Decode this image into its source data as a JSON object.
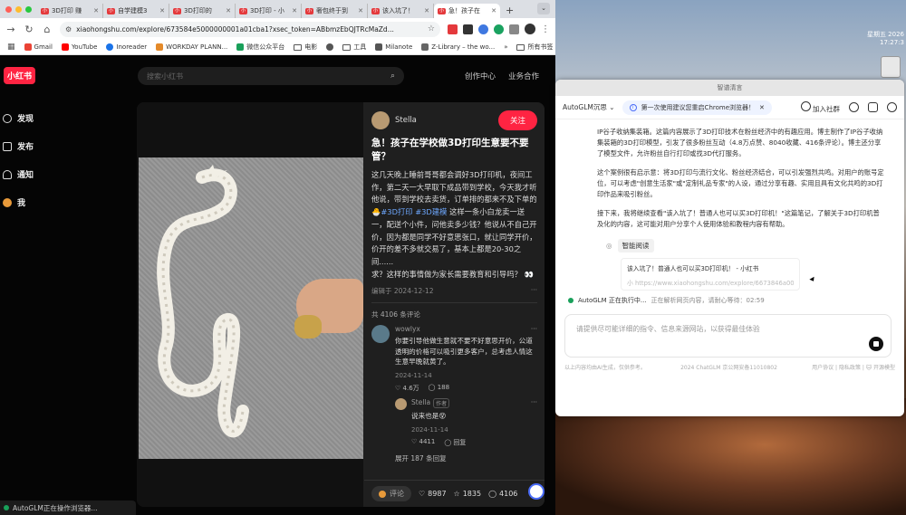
{
  "browser": {
    "tabs": [
      {
        "label": "3D打印 赚"
      },
      {
        "label": "自学建模3"
      },
      {
        "label": "3D打印的"
      },
      {
        "label": "3D打印 - 小"
      },
      {
        "label": "奢包终于到"
      },
      {
        "label": "该入坑了！"
      },
      {
        "label": "急！孩子在"
      }
    ],
    "url": "xiaohongshu.com/explore/673584e5000000001a01cba1?xsec_token=ABbmzEbQJTRcMaZd...",
    "bookmarks": [
      {
        "label": "Gmail",
        "color": "#ea4335"
      },
      {
        "label": "YouTube",
        "color": "#ff0000"
      },
      {
        "label": "Inoreader",
        "color": "#1a73e8"
      },
      {
        "label": "WORKDAY PLANN...",
        "color": "#e48a2a"
      },
      {
        "label": "微信公众平台",
        "color": "#19a05a"
      },
      {
        "label": "电影",
        "color": ""
      },
      {
        "label": "",
        "color": "#555"
      },
      {
        "label": "工具",
        "color": ""
      },
      {
        "label": "Milanote",
        "color": "#555"
      },
      {
        "label": "Z-Library – the wo...",
        "color": "#666"
      }
    ],
    "bookmarks_more": "»",
    "all_bookmarks": "所有书签"
  },
  "xhs": {
    "logo": "小红书",
    "search_placeholder": "搜索小红书",
    "header_links": [
      "创作中心",
      "业务合作"
    ],
    "sidebar": [
      {
        "label": "发现"
      },
      {
        "label": "发布"
      },
      {
        "label": "通知"
      },
      {
        "label": "我"
      }
    ],
    "note": {
      "author": "Stella",
      "follow": "关注",
      "title": "急！孩子在学校做3D打印生意要不要管？",
      "body": "这几天晚上睡前哥哥都会调好3D打印机，夜间工作，第二天一大早取下成品带到学校，今天我才听他说，带到学校去卖货，订单排的都来不及下单的🐣",
      "tags": "#3D打印 #3D建模",
      "body2": "这样一条小白龙卖一送一，配送个小件，问他卖多少钱？他说从不自己开价，因为都是同学不好意思张口，就让同学开价，价开的差不多就交易了，基本上都是20-30之间......",
      "body3": "求？这样的事情做为家长需要教育和引导吗？ 👀",
      "date": "编辑于 2024-12-12",
      "comment_count": "共 4106 条评论",
      "comment": {
        "name": "wowlyx",
        "text": "你要引导他做生意就不要不好意思开价，公道透明的价格可以吸引更多客户，总考虑人情这生意早晚就黄了。",
        "date": "2024-11-14",
        "likes": "4.6万",
        "replies": "188"
      },
      "reply": {
        "name": "Stella",
        "badge": "作者",
        "text": "说来也是😵",
        "date": "2024-11-14",
        "likes": "4411",
        "reply_label": "回复"
      },
      "expand": "展开 187 条回复",
      "bottom": {
        "comment_btn": "评论",
        "likes": "8987",
        "collects": "1835",
        "comments": "4106"
      }
    },
    "status": "AutoGLM正在操作浏览器..."
  },
  "glm": {
    "window_title": "智谱清言",
    "model": "AutoGLM沉思",
    "notice": "第一次使用建议您重启Chrome浏览器！",
    "join": "加入社群",
    "paragraphs": [
      "IP谷子收纳集装箱。这篇内容展示了3D打印技术在粉丝经济中的有趣应用。博主制作了IP谷子收纳集装箱的3D打印模型，引发了很多粉丝互动（4.8万点赞、8040收藏、416条评论）。博主还分享了模型文件，允许粉丝自行打印或找3D代打服务。",
      "这个案例很有启示意：将3D打印与流行文化、粉丝经济结合，可以引发强烈共鸣。对用户的账号定位，可以考虑\"创意生活家\"或\"定制礼品专家\"的人设，通过分享有趣、实用且具有文化共鸣的3D打印作品来吸引粉丝。",
      "接下来，我将继续查看\"该入坑了！普通人也可以买3D打印机！\"这篇笔记，了解关于3D打印机普及化的内容，这可能对用户分享个人使用体验和教程内容有帮助。"
    ],
    "smart_read": "智能阅读",
    "card_title": "该入坑了！普通人也可以买3D打印机！ - 小红书",
    "card_link": "小 https://www.xiaohongshu.com/explore/6673846a0000",
    "running": "AutoGLM 正在执行中...",
    "running_sub": "正在解析网页内容，请耐心等待：02:59",
    "input_placeholder": "请提供尽可能详细的指令、信息来源网站，以获得最佳体验",
    "footer_left": "以上内容均由AI生成，仅供参考。",
    "footer_mid": "2024 ChatGLM 京公网安备11010802",
    "footer_right": "用户协议 | 隐私政策 | 🐱 开源模型"
  },
  "desktop": {
    "clock_line1": "星期五 2026",
    "clock_line2": "17:27:3"
  }
}
